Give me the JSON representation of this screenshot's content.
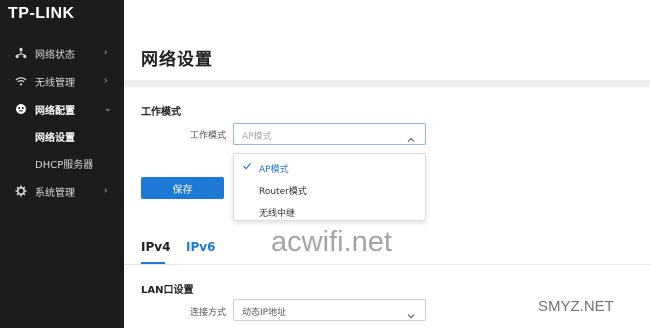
{
  "brand": {
    "logo": "TP-LINK"
  },
  "sidebar": {
    "items": [
      {
        "label": "网络状态",
        "icon": "network-status-icon"
      },
      {
        "label": "无线管理",
        "icon": "wifi-icon"
      },
      {
        "label": "网络配置",
        "icon": "network-config-icon"
      },
      {
        "label": "系统管理",
        "icon": "gear-icon"
      }
    ],
    "subitems": [
      {
        "label": "网络设置"
      },
      {
        "label": "DHCP服务器"
      }
    ]
  },
  "main": {
    "title": "网络设置",
    "work_mode": {
      "section_title": "工作模式",
      "field_label": "工作模式",
      "placeholder": "AP模式",
      "options": [
        "AP模式",
        "Router模式",
        "无线中继"
      ],
      "selected": "AP模式"
    },
    "save_label": "保存",
    "tabs": [
      {
        "label": "IPv4"
      },
      {
        "label": "IPv6"
      }
    ],
    "lan": {
      "section_title": "LAN口设置",
      "field_label": "连接方式",
      "value": "动态IP地址"
    }
  },
  "watermarks": {
    "primary": "acwifi.net",
    "secondary": "SMYZ.NET"
  },
  "colors": {
    "accent": "#1e78d6",
    "sidebar_bg": "#1c1c1c"
  }
}
